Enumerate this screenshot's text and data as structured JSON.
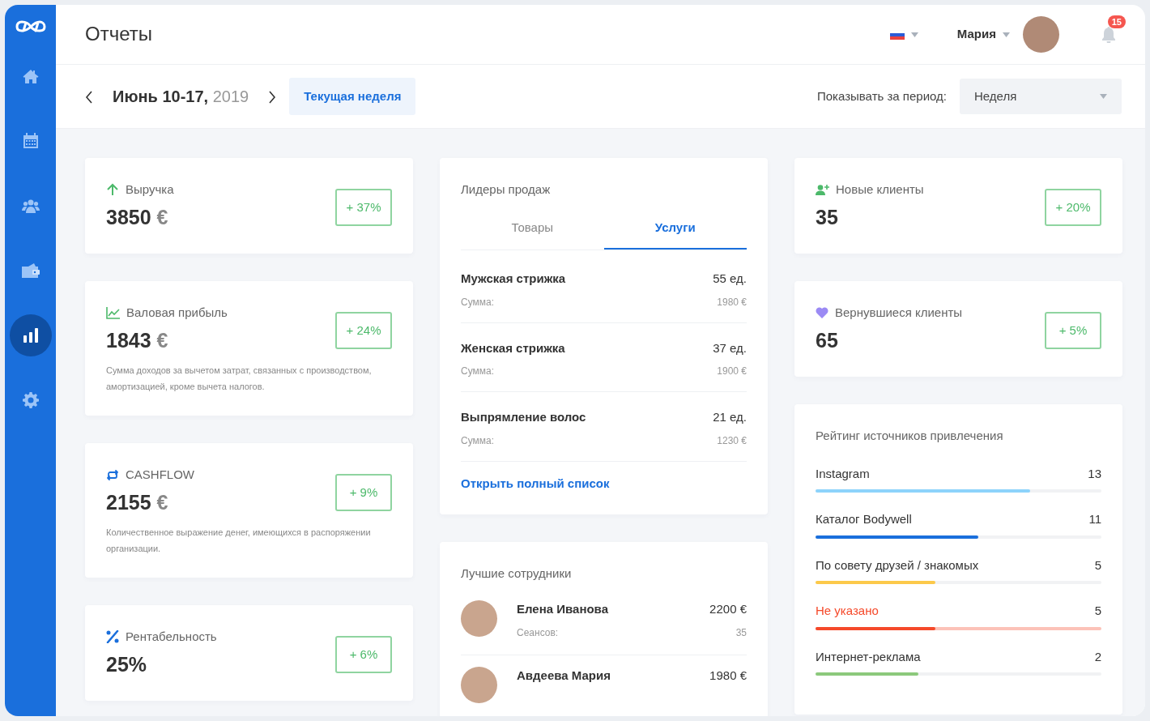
{
  "sidebar": {
    "items": [
      {
        "kind": "home",
        "selected": false
      },
      {
        "kind": "calendar",
        "selected": false
      },
      {
        "kind": "users",
        "selected": false
      },
      {
        "kind": "wallet",
        "selected": false
      },
      {
        "kind": "chart",
        "selected": true
      },
      {
        "kind": "settings",
        "selected": false
      }
    ]
  },
  "header": {
    "title": "Отчеты",
    "user": {
      "name": "Мария"
    },
    "notifications": {
      "count": "15"
    }
  },
  "toolbar": {
    "period": "Июнь 10-17,",
    "year": "2019",
    "current_week_button": "Текущая неделя",
    "period_label": "Показывать за период:",
    "period_select": {
      "value": "Неделя"
    }
  },
  "left_cards": [
    {
      "kind": "arrow-up",
      "title": "Выручка",
      "amount": "3850",
      "unit": "€",
      "change": "+ 37%"
    },
    {
      "kind": "line-chart",
      "title": "Валовая прибыль",
      "amount": "1843",
      "unit": "€",
      "description": "Сумма доходов за вычетом затрат, связанных с производством, амортизацией, кроме вычета налогов.",
      "change": "+ 24%"
    },
    {
      "kind": "cycle",
      "title": "CASHFLOW",
      "amount": "2155",
      "unit": "€",
      "description": "Количественное выражение денег, имеющихся в распоряжении организации.",
      "change": "+ 9%"
    },
    {
      "kind": "percent",
      "title": "Рентабельность",
      "amount": "25%",
      "change": "+ 6%"
    }
  ],
  "sales_leaders": {
    "title": "Лидеры продаж",
    "tabs": [
      {
        "label": "Товары",
        "selected": false
      },
      {
        "label": "Услуги",
        "selected": true
      }
    ],
    "items": [
      {
        "name": "Мужская стрижка",
        "quantity": "55 ед.",
        "sum_label": "Сумма:",
        "sum": "1980 €"
      },
      {
        "name": "Женская стрижка",
        "quantity": "37 ед.",
        "sum_label": "Сумма:",
        "sum": "1900 €"
      },
      {
        "name": "Выпрямление волос",
        "quantity": "21 ед.",
        "sum_label": "Сумма:",
        "sum": "1230 €"
      }
    ],
    "link": "Открыть полный список"
  },
  "top_employees": {
    "title": "Лучшие сотрудники",
    "items": [
      {
        "name": "Елена Иванова",
        "amount": "2200 €",
        "sessions_label": "Сеансов:",
        "sessions": "35"
      },
      {
        "name": "Авдеева Мария",
        "amount": "1980 €"
      }
    ]
  },
  "right_cards": [
    {
      "kind": "user-plus",
      "title": "Новые клиенты",
      "amount": "35",
      "change": "+ 20%"
    },
    {
      "kind": "heart",
      "title": "Вернувшиеся клиенты",
      "amount": "65",
      "change": "+ 5%"
    }
  ],
  "sources": {
    "title": "Рейтинг источников привлечения",
    "items": [
      {
        "label": "Instagram",
        "count": "13",
        "level": 0.75,
        "color": "#8dd3fb",
        "alert": false
      },
      {
        "label": "Каталог Bodywell",
        "count": "11",
        "level": 0.57,
        "color": "#1a6fdc",
        "alert": false
      },
      {
        "label": "По совету друзей / знакомых",
        "count": "5",
        "level": 0.42,
        "color": "#fcc94a",
        "alert": false
      },
      {
        "label": "Не указано",
        "count": "5",
        "level": 0.42,
        "color": "#f5492a",
        "alert": true
      },
      {
        "label": "Интернет-реклама",
        "count": "2",
        "level": 0.36,
        "color": "#8cc97c",
        "alert": false
      }
    ]
  }
}
